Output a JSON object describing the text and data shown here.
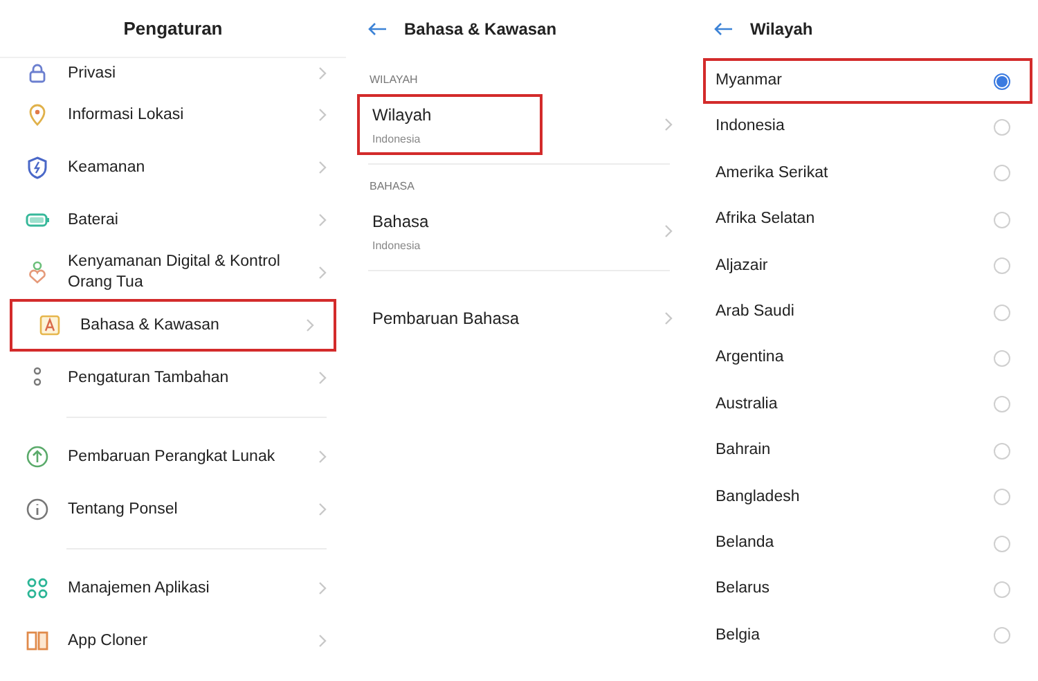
{
  "settings": {
    "title": "Pengaturan",
    "groups": [
      [
        {
          "label": "Privasi",
          "highlighted": false
        },
        {
          "label": "Informasi Lokasi",
          "highlighted": false
        },
        {
          "label": "Keamanan",
          "highlighted": false
        },
        {
          "label": "Baterai",
          "highlighted": false
        },
        {
          "label": "Kenyamanan Digital & Kontrol Orang Tua",
          "highlighted": false
        },
        {
          "label": "Bahasa & Kawasan",
          "highlighted": true
        },
        {
          "label": "Pengaturan Tambahan",
          "highlighted": false
        }
      ],
      [
        {
          "label": "Pembaruan Perangkat Lunak",
          "highlighted": false
        },
        {
          "label": "Tentang Ponsel",
          "highlighted": false
        }
      ],
      [
        {
          "label": "Manajemen Aplikasi",
          "highlighted": false
        },
        {
          "label": "App Cloner",
          "highlighted": false
        }
      ]
    ]
  },
  "language_region": {
    "title": "Bahasa & Kawasan",
    "sections": [
      {
        "heading": "WILAYAH",
        "items": [
          {
            "label": "Wilayah",
            "value": "Indonesia",
            "highlighted": true
          }
        ]
      },
      {
        "heading": "BAHASA",
        "items": [
          {
            "label": "Bahasa",
            "value": "Indonesia",
            "highlighted": false
          }
        ]
      },
      {
        "items": [
          {
            "label": "Pembaruan Bahasa",
            "highlighted": false
          }
        ]
      }
    ]
  },
  "region": {
    "title": "Wilayah",
    "options": [
      {
        "label": "Myanmar",
        "selected": true,
        "highlighted": true
      },
      {
        "label": "Indonesia",
        "selected": false,
        "highlighted": false
      },
      {
        "label": "Amerika Serikat",
        "selected": false,
        "highlighted": false
      },
      {
        "label": "Afrika Selatan",
        "selected": false,
        "highlighted": false
      },
      {
        "label": "Aljazair",
        "selected": false,
        "highlighted": false
      },
      {
        "label": "Arab Saudi",
        "selected": false,
        "highlighted": false
      },
      {
        "label": "Argentina",
        "selected": false,
        "highlighted": false
      },
      {
        "label": "Australia",
        "selected": false,
        "highlighted": false
      },
      {
        "label": "Bahrain",
        "selected": false,
        "highlighted": false
      },
      {
        "label": "Bangladesh",
        "selected": false,
        "highlighted": false
      },
      {
        "label": "Belanda",
        "selected": false,
        "highlighted": false
      },
      {
        "label": "Belarus",
        "selected": false,
        "highlighted": false
      },
      {
        "label": "Belgia",
        "selected": false,
        "highlighted": false
      }
    ]
  }
}
